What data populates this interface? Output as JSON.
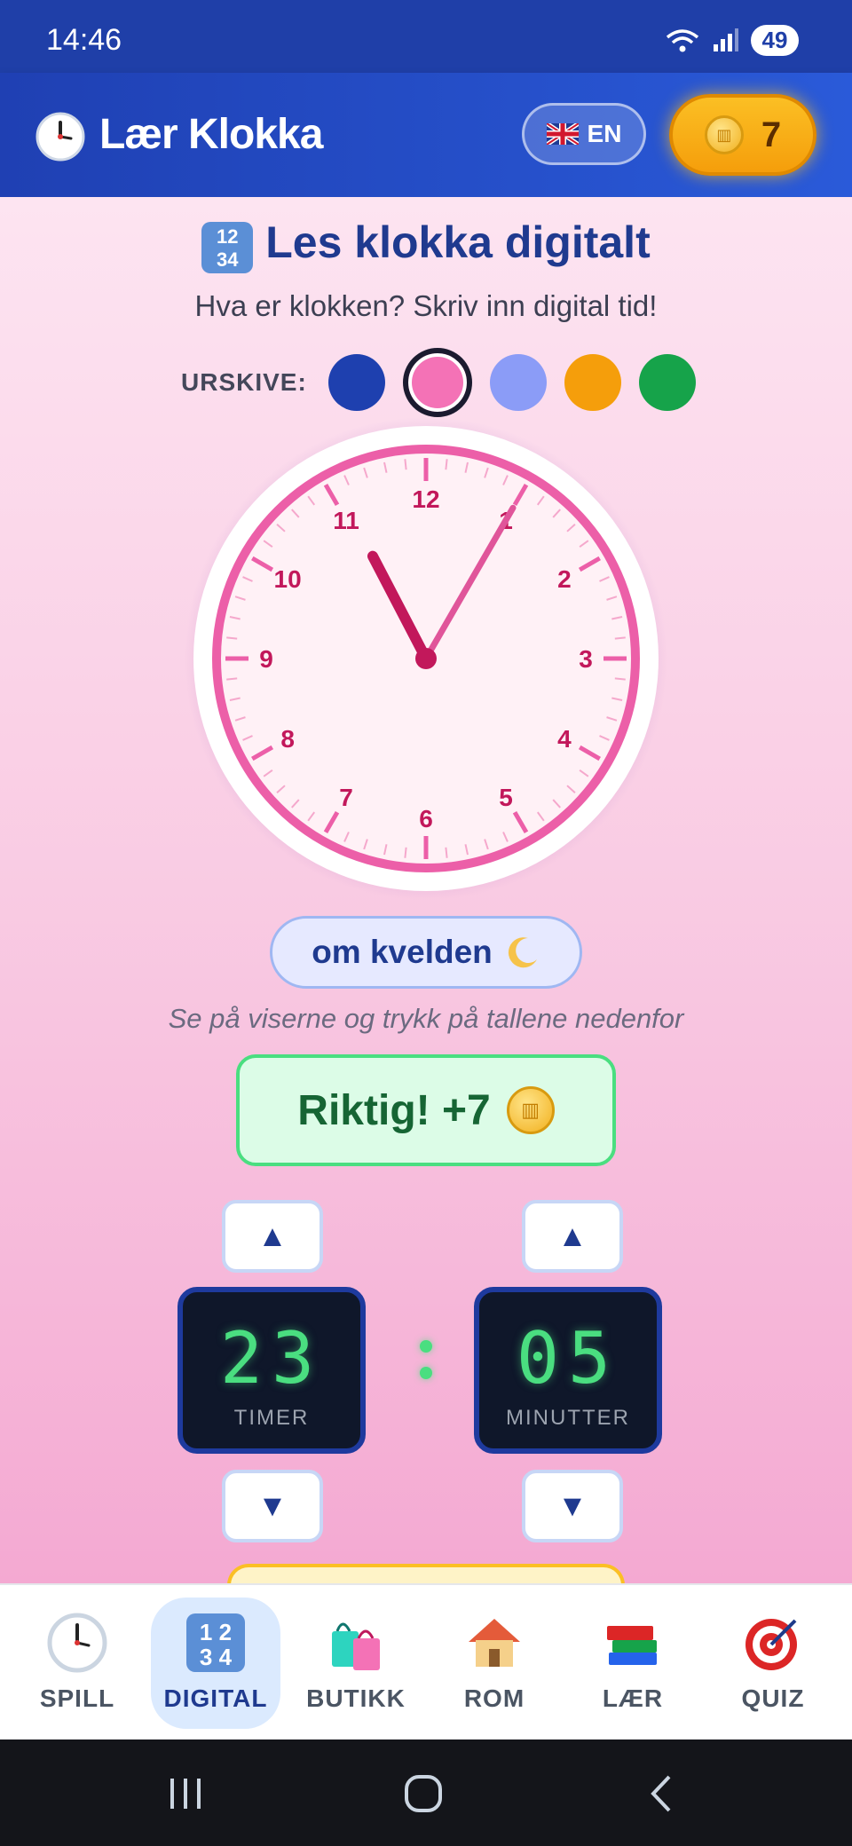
{
  "status_bar": {
    "time": "14:46",
    "battery": "49"
  },
  "header": {
    "title": "Lær Klokka",
    "language_button": "EN",
    "coins": "7"
  },
  "main": {
    "title": "Les klokka digitalt",
    "title_icon_text": "1234",
    "subtitle": "Hva er klokken? Skriv inn digital tid!",
    "dial_label": "URSKIVE:",
    "dial_colors": [
      "#1e40af",
      "#f472b6",
      "#8b9cf7",
      "#f59e0b",
      "#16a34a"
    ],
    "selected_dial_color_index": 1,
    "clock": {
      "numbers": [
        "12",
        "1",
        "2",
        "3",
        "4",
        "5",
        "6",
        "7",
        "8",
        "9",
        "10",
        "11"
      ],
      "hour": 11,
      "minute": 5,
      "accent_color": "#ec5fa8",
      "hand_color": "#c2185b"
    },
    "period_button": "om kvelden",
    "hint": "Se på viserne og trykk på tallene nedenfor",
    "result_text": "Riktig! +7",
    "hours_value": "23",
    "hours_label": "TIMER",
    "minutes_value": "05",
    "minutes_label": "MINUTTER",
    "stepper_up": "▲",
    "stepper_down": "▼"
  },
  "bottom_nav": {
    "items": [
      {
        "label": "SPILL",
        "icon": "clock-icon",
        "active": false
      },
      {
        "label": "DIGITAL",
        "icon": "numbers-icon",
        "active": true
      },
      {
        "label": "BUTIKK",
        "icon": "shopping-bags-icon",
        "active": false
      },
      {
        "label": "ROM",
        "icon": "house-icon",
        "active": false
      },
      {
        "label": "LÆR",
        "icon": "books-icon",
        "active": false
      },
      {
        "label": "QUIZ",
        "icon": "target-icon",
        "active": false
      }
    ]
  }
}
